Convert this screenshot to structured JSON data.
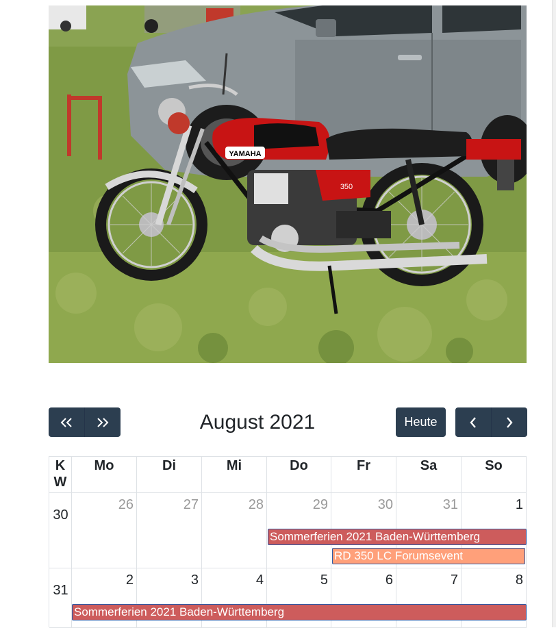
{
  "image": {
    "alt": "YAMAHA",
    "tank_brand": "YAMAHA",
    "side_cover": "350"
  },
  "toolbar": {
    "prev_year_icon": "double-chevron-left-icon",
    "next_year_icon": "double-chevron-right-icon",
    "title": "August 2021",
    "today_label": "Heute",
    "prev_month_icon": "chevron-left-icon",
    "next_month_icon": "chevron-right-icon"
  },
  "calendar": {
    "kw_header": [
      "K",
      "W"
    ],
    "weekdays": [
      "Mo",
      "Di",
      "Mi",
      "Do",
      "Fr",
      "Sa",
      "So"
    ],
    "weeks": [
      {
        "kw": "30",
        "days": [
          {
            "num": "26",
            "other": true
          },
          {
            "num": "27",
            "other": true
          },
          {
            "num": "28",
            "other": true
          },
          {
            "num": "29",
            "other": true
          },
          {
            "num": "30",
            "other": true
          },
          {
            "num": "31",
            "other": true
          },
          {
            "num": "1",
            "other": false
          }
        ],
        "events": [
          {
            "title": "Sommerferien 2021 Baden-Württemberg",
            "color": "#cd5c5c"
          },
          {
            "title": "RD 350 LC Forumsevent",
            "color": "#ffa07a"
          }
        ]
      },
      {
        "kw": "31",
        "days": [
          {
            "num": "2",
            "other": false
          },
          {
            "num": "3",
            "other": false
          },
          {
            "num": "4",
            "other": false
          },
          {
            "num": "5",
            "other": false
          },
          {
            "num": "6",
            "other": false
          },
          {
            "num": "7",
            "other": false
          },
          {
            "num": "8",
            "other": false
          }
        ],
        "events": [
          {
            "title": "Sommerferien 2021 Baden-Württemberg",
            "color": "#cd5c5c"
          }
        ]
      }
    ]
  },
  "colors": {
    "button_bg": "#2c3e50",
    "event_red": "#cd5c5c",
    "event_orange": "#ffa07a",
    "event_border": "#2c5ba8"
  }
}
